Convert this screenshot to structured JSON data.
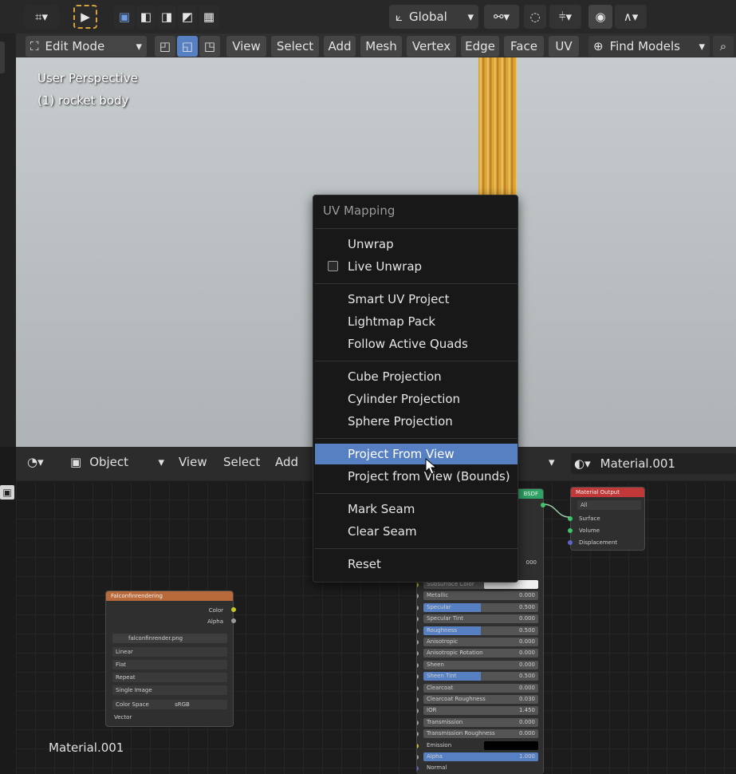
{
  "toolbar": {
    "transform_orientation": "Global"
  },
  "header": {
    "mode": "Edit Mode",
    "menus": [
      "View",
      "Select",
      "Add",
      "Mesh",
      "Vertex",
      "Edge",
      "Face",
      "UV"
    ],
    "find_models": "Find Models"
  },
  "viewport": {
    "perspective": "User Perspective",
    "object": "(1) rocket body"
  },
  "uv_menu": {
    "title": "UV Mapping",
    "groups": [
      [
        "Unwrap",
        "Live Unwrap"
      ],
      [
        "Smart UV Project",
        "Lightmap Pack",
        "Follow Active Quads"
      ],
      [
        "Cube Projection",
        "Cylinder Projection",
        "Sphere Projection"
      ],
      [
        "Project From View",
        "Project from View (Bounds)"
      ],
      [
        "Mark Seam",
        "Clear Seam"
      ],
      [
        "Reset"
      ]
    ],
    "highlighted": "Project From View"
  },
  "node_editor": {
    "object_dropdown": "Object",
    "menus": [
      "View",
      "Select",
      "Add"
    ],
    "material": "Material.001",
    "footer_label": "Material.001"
  },
  "image_node": {
    "title": "Falconfinrendering",
    "outputs": [
      "Color",
      "Alpha"
    ],
    "image_name": "falconfinrender.png",
    "fields": [
      "Linear",
      "Flat",
      "Repeat",
      "Single Image"
    ],
    "color_space_label": "Color Space",
    "color_space_value": "sRGB",
    "input": "Vector"
  },
  "output_node": {
    "title": "Material Output",
    "target": "All",
    "inputs": [
      "Surface",
      "Volume",
      "Displacement"
    ]
  },
  "bsdf_node": {
    "partial_title": "BSDF",
    "partial_value": "000",
    "rows": [
      {
        "label": "Subsurface Color",
        "value": ""
      },
      {
        "label": "Metallic",
        "value": "0.000"
      },
      {
        "label": "Specular",
        "value": "0.500"
      },
      {
        "label": "Specular Tint",
        "value": "0.000"
      },
      {
        "label": "Roughness",
        "value": "0.500"
      },
      {
        "label": "Anisotropic",
        "value": "0.000"
      },
      {
        "label": "Anisotropic Rotation",
        "value": "0.000"
      },
      {
        "label": "Sheen",
        "value": "0.000"
      },
      {
        "label": "Sheen Tint",
        "value": "0.500"
      },
      {
        "label": "Clearcoat",
        "value": "0.000"
      },
      {
        "label": "Clearcoat Roughness",
        "value": "0.030"
      },
      {
        "label": "IOR",
        "value": "1.450"
      },
      {
        "label": "Transmission",
        "value": "0.000"
      },
      {
        "label": "Transmission Roughness",
        "value": "0.000"
      },
      {
        "label": "Emission",
        "value": ""
      },
      {
        "label": "Alpha",
        "value": "1.000"
      },
      {
        "label": "Normal",
        "value": ""
      }
    ]
  },
  "colors": {
    "accent": "#5680c2",
    "rocket": "#e0a83a",
    "node_texture": "#b86a3a",
    "node_output": "#c13838",
    "node_shader": "#2fa265"
  },
  "icons": [
    "editor-type-icon",
    "select-tool-icon",
    "select-box-icon",
    "transform-pivot-icon",
    "snap-icon",
    "proportional-icon",
    "globe-icon",
    "search-icon",
    "shading-icon",
    "material-sphere-icon",
    "image-icon"
  ]
}
